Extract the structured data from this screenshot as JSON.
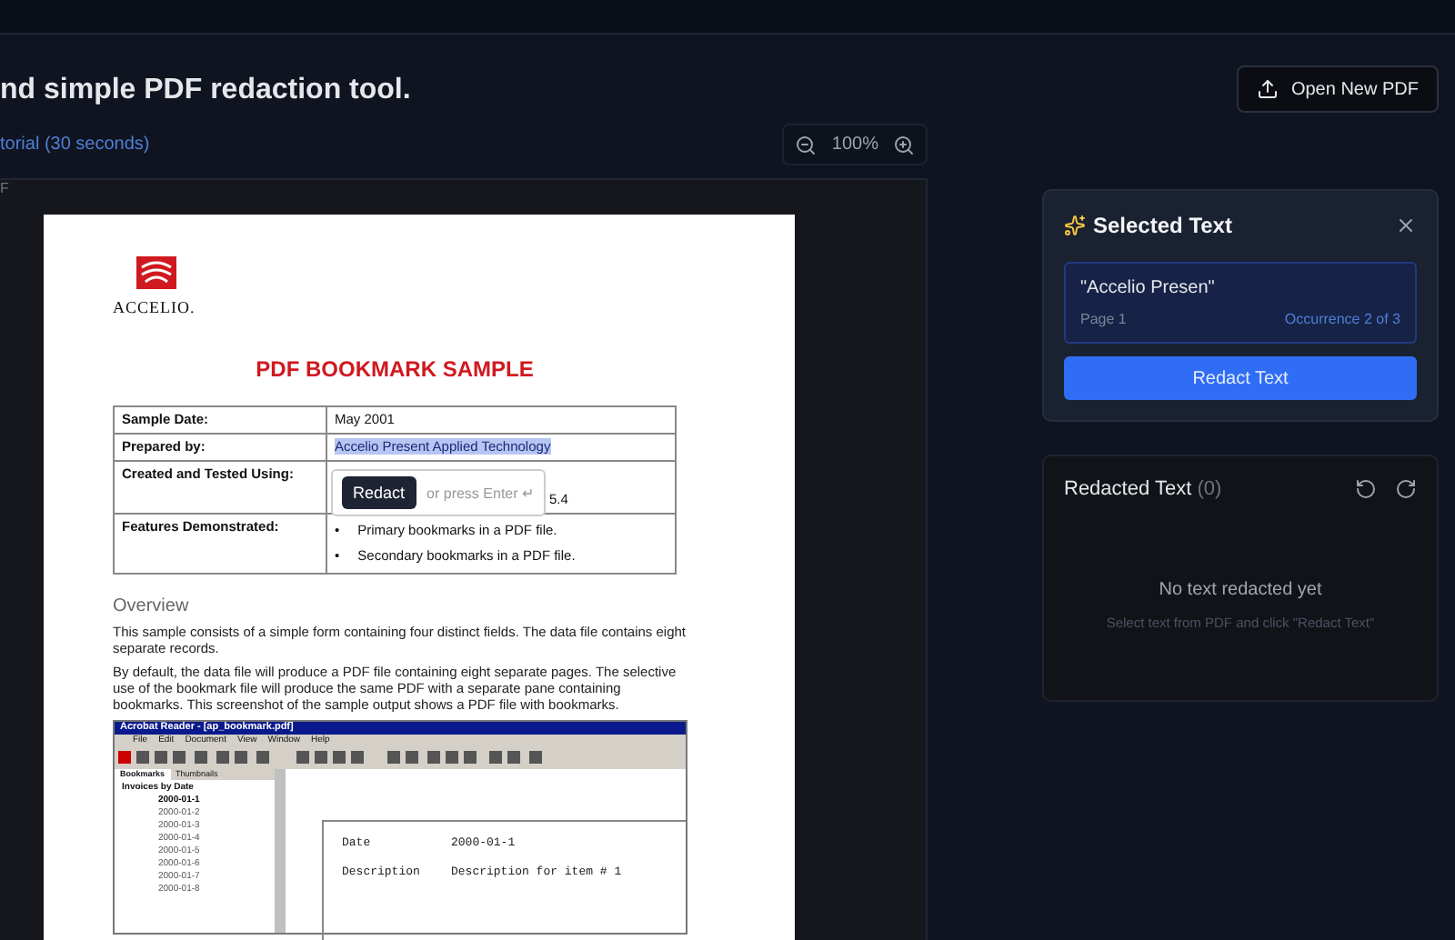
{
  "header": {
    "tagline": "nd simple PDF redaction tool.",
    "tutorial_link": "torial (30 seconds)",
    "open_button": "Open New PDF"
  },
  "zoom": {
    "value": "100%"
  },
  "viewer": {
    "label": "F",
    "page": {
      "logo_text": "ACCELIO.",
      "title": "PDF BOOKMARK SAMPLE",
      "table": [
        {
          "label": "Sample Date:",
          "values": [
            "May 2001"
          ]
        },
        {
          "label": "Prepared by:",
          "values": [
            "Accelio Present Applied Technology"
          ],
          "highlighted": true
        },
        {
          "label": "Created and Tested Using:",
          "values": [
            "5.4"
          ]
        },
        {
          "label": "Features Demonstrated:",
          "values": [
            "Primary bookmarks in a PDF file.",
            "Secondary bookmarks in a PDF file."
          ],
          "bullet": "•",
          "kind": "bullets"
        }
      ],
      "overview_heading": "Overview",
      "paragraphs": [
        "This sample consists of a simple form containing four distinct fields. The data file contains eight separate records.",
        "By default, the data file will produce a PDF file containing eight separate pages. The selective use of the bookmark file will produce the same PDF with a separate pane containing bookmarks. This screenshot of the sample output shows a PDF file with bookmarks."
      ],
      "screenshot": {
        "title": "Acrobat Reader - [ap_bookmark.pdf]",
        "menu": [
          "File",
          "Edit",
          "Document",
          "View",
          "Window",
          "Help"
        ],
        "tabs": [
          {
            "label": "Bookmarks",
            "selected": true
          },
          {
            "label": "Thumbnails",
            "selected": false
          }
        ],
        "tree": {
          "label": "Invoices by Date",
          "children": [
            {
              "label": "2000-01-1",
              "selected": true
            },
            {
              "label": "2000-01-2",
              "selected": false
            },
            {
              "label": "2000-01-3",
              "selected": false
            },
            {
              "label": "2000-01-4",
              "selected": false
            },
            {
              "label": "2000-01-5",
              "selected": false
            },
            {
              "label": "2000-01-6",
              "selected": false
            },
            {
              "label": "2000-01-7",
              "selected": false
            },
            {
              "label": "2000-01-8",
              "selected": false
            }
          ]
        },
        "fields": [
          {
            "label": "Date",
            "value": "2000-01-1"
          },
          {
            "label": "Description",
            "value": "Description for item # 1"
          }
        ]
      }
    },
    "popup": {
      "button": "Redact",
      "hint": "or press Enter ↵"
    }
  },
  "selected_panel": {
    "title": "Selected Text",
    "quote": "\"Accelio Presen\"",
    "page": "Page 1",
    "occurrence": "Occurrence 2 of 3",
    "button": "Redact Text"
  },
  "redacted_panel": {
    "title": "Redacted Text",
    "count": "(0)",
    "empty_title": "No text redacted yet",
    "empty_hint": "Select text from PDF and click \"Redact Text\""
  }
}
